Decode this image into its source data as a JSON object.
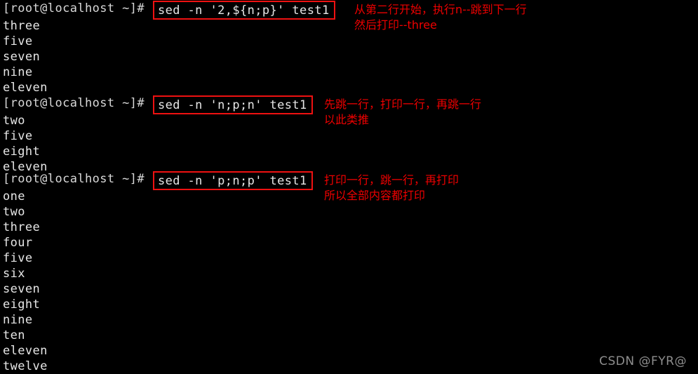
{
  "terminal": {
    "prompt": "[root@localhost ~]#",
    "watermark": "CSDN @FYR@",
    "blocks": [
      {
        "command": "sed -n '2,${n;p}' test1",
        "annotation_line1": "从第二行开始，执行n--跳到下一行",
        "annotation_line2": "然后打印--three",
        "output": [
          "three",
          "five",
          "seven",
          "nine",
          "eleven"
        ]
      },
      {
        "command": "sed -n 'n;p;n' test1",
        "annotation_line1": "先跳一行，打印一行，再跳一行",
        "annotation_line2": "以此类推",
        "output": [
          "two",
          "five",
          "eight",
          "eleven"
        ]
      },
      {
        "command": "sed -n 'p;n;p' test1",
        "annotation_line1": "打印一行，跳一行，再打印",
        "annotation_line2": "所以全部内容都打印",
        "output": [
          "one",
          "two",
          "three",
          "four",
          "five",
          "six",
          "seven",
          "eight",
          "nine",
          "ten",
          "eleven",
          "twelve"
        ]
      }
    ]
  },
  "colors": {
    "background": "#000000",
    "text": "#e6e6e6",
    "annotation": "#ee0000",
    "box_border": "#ee1111",
    "watermark": "#8e8e8e"
  }
}
